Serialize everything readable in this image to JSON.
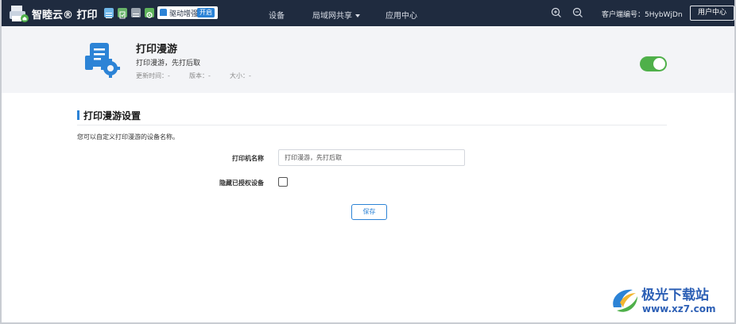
{
  "topbar": {
    "brand": "智睦云® 打印",
    "driver_pill_label": "驱动增强",
    "driver_pill_badge": "开启",
    "nav": [
      {
        "label": "设备"
      },
      {
        "label": "局域网共享"
      },
      {
        "label": "应用中心"
      }
    ],
    "customer_id": "客户端编号：5HybWjDn",
    "user_center": "用户中心",
    "colors": {
      "bg": "#1f2b3f",
      "accent": "#2c83d6"
    },
    "icons": [
      "logo-printer-icon",
      "grid-icon",
      "document-icon",
      "list-icon",
      "gear-icon",
      "zoom-in-icon",
      "zoom-out-icon"
    ]
  },
  "feature": {
    "title": "打印漫游",
    "description": "打印漫游，先打后取",
    "update_time": "更新时间：-",
    "version": "版本：-",
    "size": "大小：-",
    "enabled": true,
    "toggle_color": "#4fb04a"
  },
  "settings": {
    "section_title": "打印漫游设置",
    "description": "您可以自定义打印漫游的设备名称。",
    "printer_name_label": "打印机名称",
    "printer_name_value": "打印漫游，先打后取",
    "hide_authorized_label": "隐藏已授权设备",
    "hide_authorized_checked": false,
    "save_label": "保存"
  },
  "watermark": {
    "text": "极光下载站",
    "url": "www.xz7.com"
  }
}
